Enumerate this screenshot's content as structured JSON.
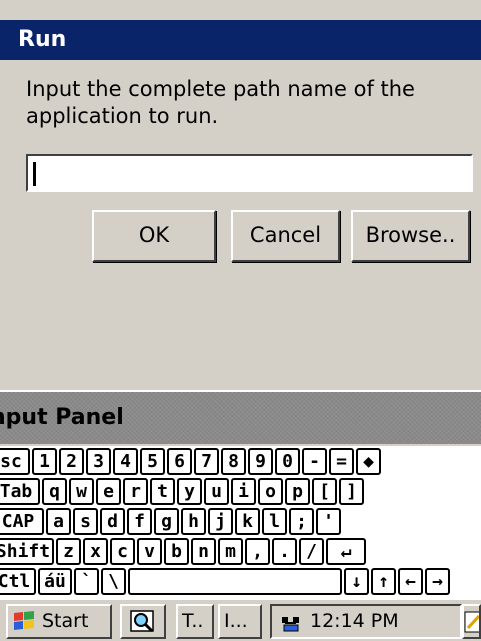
{
  "dialog": {
    "title": "Run",
    "prompt": "Input the complete path name of the application to run.",
    "path_value": "",
    "buttons": {
      "ok": "OK",
      "cancel": "Cancel",
      "browse": "Browse.."
    }
  },
  "input_panel": {
    "title": "nput Panel",
    "rows": [
      [
        "sc",
        "1",
        "2",
        "3",
        "4",
        "5",
        "6",
        "7",
        "8",
        "9",
        "0",
        "-",
        "=",
        "◆"
      ],
      [
        "Tab",
        "q",
        "w",
        "e",
        "r",
        "t",
        "y",
        "u",
        "i",
        "o",
        "p",
        "[",
        "]"
      ],
      [
        "CAP",
        "a",
        "s",
        "d",
        "f",
        "g",
        "h",
        "j",
        "k",
        "l",
        ";",
        "'"
      ],
      [
        "Shift",
        "z",
        "x",
        "c",
        "v",
        "b",
        "n",
        "m",
        ",",
        ".",
        "/",
        "↵"
      ],
      [
        "Ctl",
        "áü",
        "`",
        "\\",
        "",
        "↓",
        "↑",
        "←",
        "→"
      ]
    ]
  },
  "taskbar": {
    "start_label": "Start",
    "tasks": [
      "T..",
      "I..."
    ],
    "clock": "12:14 PM",
    "icons": {
      "start": "windows-flag-icon",
      "search": "search-icon",
      "tray": "network-icon",
      "pen": "pen-icon"
    }
  },
  "colors": {
    "title_bar": "#0a246a",
    "face": "#d4d0c8",
    "panel_title": "#8a8a8a"
  }
}
